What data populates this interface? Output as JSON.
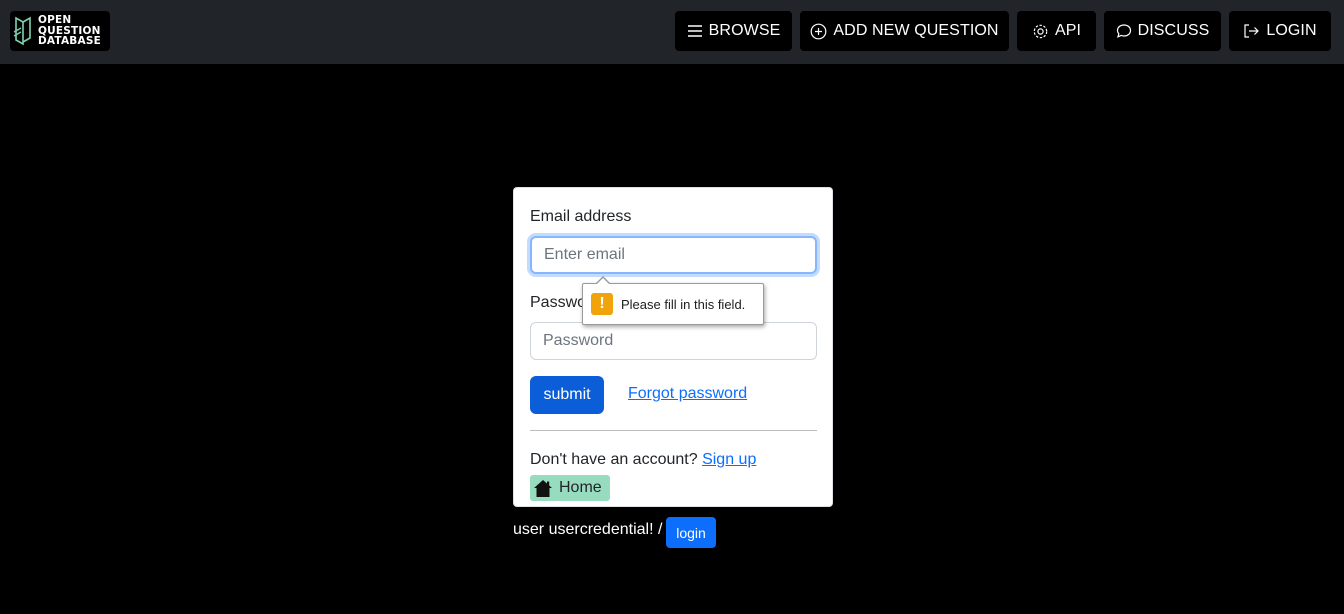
{
  "navbar": {
    "logo": {
      "line1": "OPEN",
      "line2": "QUESTION",
      "line3": "DATABASE"
    },
    "buttons": [
      {
        "label": "BROWSE",
        "icon": "menu-icon"
      },
      {
        "label": "ADD NEW QUESTION",
        "icon": "plus-circle-icon"
      },
      {
        "label": "API",
        "icon": "gear-icon"
      },
      {
        "label": "DISCUSS",
        "icon": "chat-icon"
      },
      {
        "label": "LOGIN",
        "icon": "login-icon"
      }
    ]
  },
  "form": {
    "email_label": "Email address",
    "email_placeholder": "Enter email",
    "password_label": "Passwo",
    "password_placeholder": "Password",
    "submit_label": "submit",
    "forgot_label": "Forgot password",
    "no_account_text": "Don't have an account?",
    "signup_label": "Sign up",
    "home_label": "Home"
  },
  "validation_tooltip": {
    "message": "Please fill in this field.",
    "icon": "warning-icon"
  },
  "footer": {
    "user_text": "user usercredential! /",
    "login_label": "login"
  },
  "colors": {
    "navbar_bg": "#212529",
    "page_bg": "#000000",
    "primary": "#0d6efd",
    "home_bg": "#98dcc0",
    "warning": "#f0a30a"
  }
}
